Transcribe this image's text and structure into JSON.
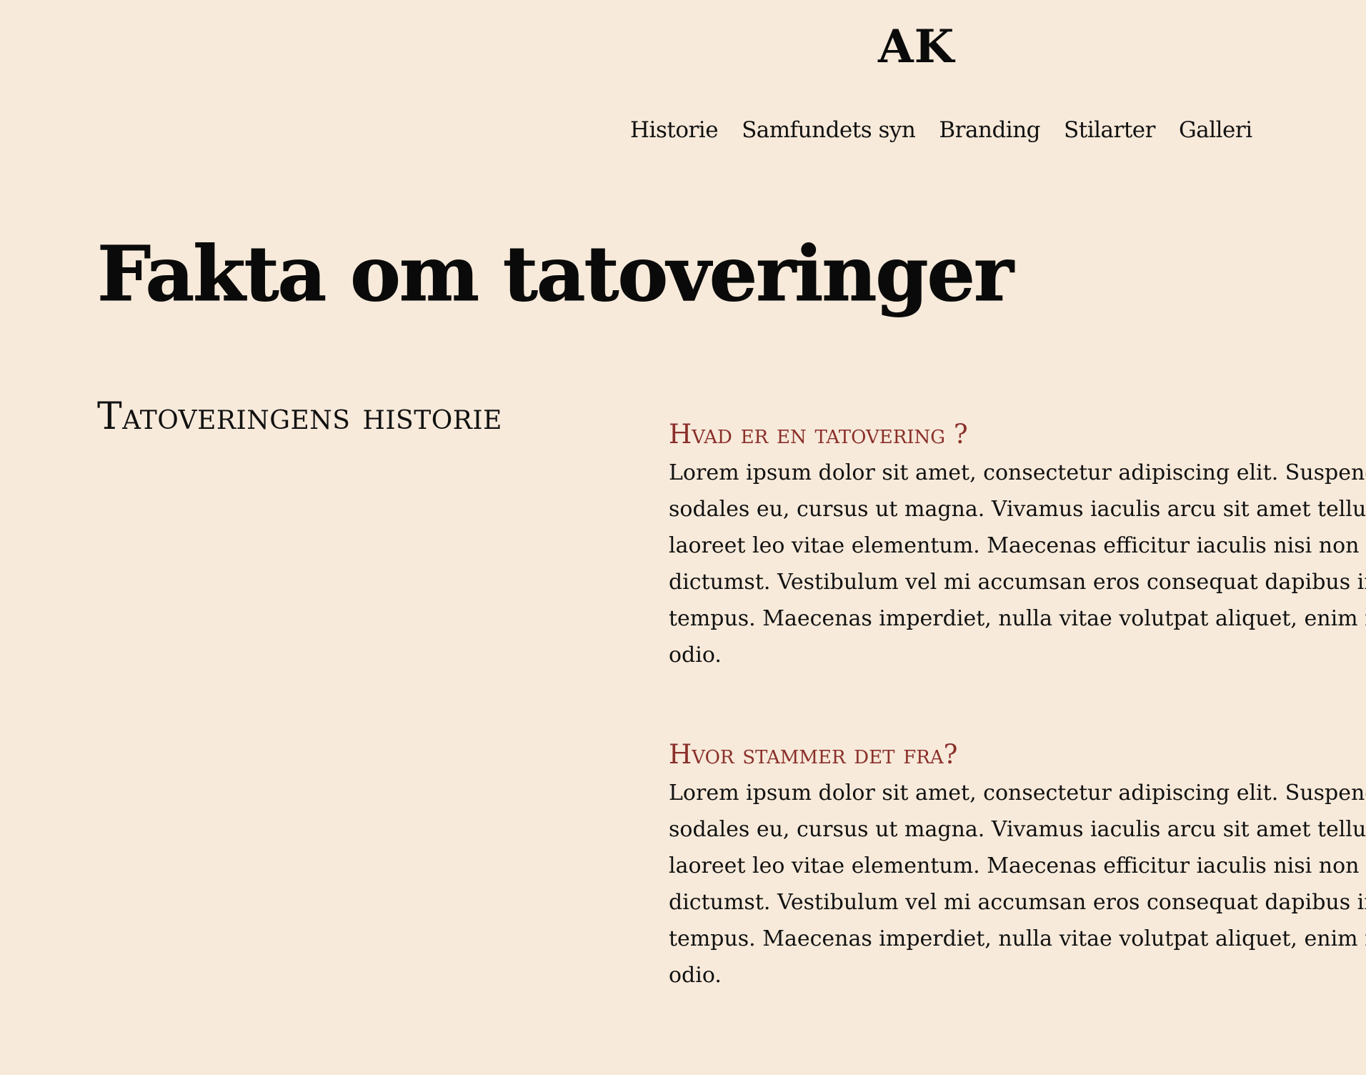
{
  "header": {
    "logo": "AK",
    "nav": [
      "Historie",
      "Samfundets syn",
      "Branding",
      "Stilarter",
      "Galleri"
    ]
  },
  "page_title": "Fakta om tatoveringer",
  "section_title": "Tatoveringens historie",
  "articles": [
    {
      "heading": "Hvad er en tatovering ?",
      "lines": [
        "Lorem ipsum dolor sit amet, consectetur adipiscing elit. Suspendisse ip",
        "sodales eu, cursus ut magna. Vivamus iaculis arcu sit amet tellus bibe",
        "laoreet leo vitae elementum. Maecenas efficitur iaculis nisi non euism",
        "dictumst. Vestibulum vel mi accumsan eros consequat dapibus in sed",
        "tempus. Maecenas imperdiet, nulla vitae volutpat aliquet, enim mi tinc",
        "odio."
      ]
    },
    {
      "heading": "Hvor stammer det fra?",
      "lines": [
        "Lorem ipsum dolor sit amet, consectetur adipiscing elit. Suspendisse ip",
        "sodales eu, cursus ut magna. Vivamus iaculis arcu sit amet tellus bibe",
        "laoreet leo vitae elementum. Maecenas efficitur iaculis nisi non euism",
        "dictumst. Vestibulum vel mi accumsan eros consequat dapibus in sed",
        "tempus. Maecenas imperdiet, nulla vitae volutpat aliquet, enim mi tinc",
        "odio."
      ]
    }
  ],
  "colors": {
    "background": "#f7eada",
    "accent": "#8a2f2a",
    "text": "#111111"
  }
}
